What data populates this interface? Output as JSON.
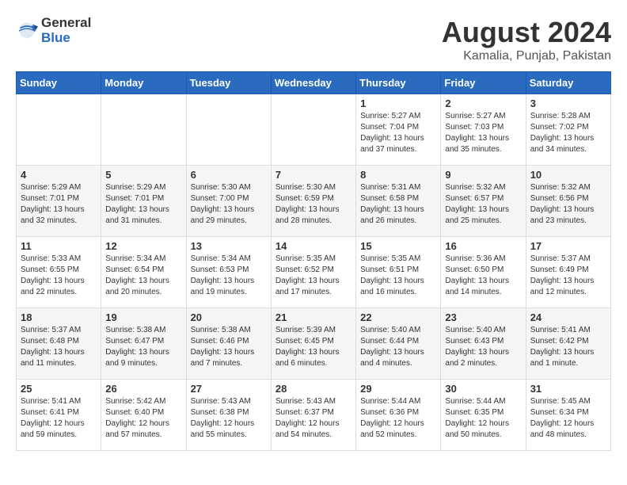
{
  "header": {
    "logo_general": "General",
    "logo_blue": "Blue",
    "month_year": "August 2024",
    "location": "Kamalia, Punjab, Pakistan"
  },
  "days_of_week": [
    "Sunday",
    "Monday",
    "Tuesday",
    "Wednesday",
    "Thursday",
    "Friday",
    "Saturday"
  ],
  "weeks": [
    [
      {
        "day": "",
        "info": ""
      },
      {
        "day": "",
        "info": ""
      },
      {
        "day": "",
        "info": ""
      },
      {
        "day": "",
        "info": ""
      },
      {
        "day": "1",
        "info": "Sunrise: 5:27 AM\nSunset: 7:04 PM\nDaylight: 13 hours and 37 minutes."
      },
      {
        "day": "2",
        "info": "Sunrise: 5:27 AM\nSunset: 7:03 PM\nDaylight: 13 hours and 35 minutes."
      },
      {
        "day": "3",
        "info": "Sunrise: 5:28 AM\nSunset: 7:02 PM\nDaylight: 13 hours and 34 minutes."
      }
    ],
    [
      {
        "day": "4",
        "info": "Sunrise: 5:29 AM\nSunset: 7:01 PM\nDaylight: 13 hours and 32 minutes."
      },
      {
        "day": "5",
        "info": "Sunrise: 5:29 AM\nSunset: 7:01 PM\nDaylight: 13 hours and 31 minutes."
      },
      {
        "day": "6",
        "info": "Sunrise: 5:30 AM\nSunset: 7:00 PM\nDaylight: 13 hours and 29 minutes."
      },
      {
        "day": "7",
        "info": "Sunrise: 5:30 AM\nSunset: 6:59 PM\nDaylight: 13 hours and 28 minutes."
      },
      {
        "day": "8",
        "info": "Sunrise: 5:31 AM\nSunset: 6:58 PM\nDaylight: 13 hours and 26 minutes."
      },
      {
        "day": "9",
        "info": "Sunrise: 5:32 AM\nSunset: 6:57 PM\nDaylight: 13 hours and 25 minutes."
      },
      {
        "day": "10",
        "info": "Sunrise: 5:32 AM\nSunset: 6:56 PM\nDaylight: 13 hours and 23 minutes."
      }
    ],
    [
      {
        "day": "11",
        "info": "Sunrise: 5:33 AM\nSunset: 6:55 PM\nDaylight: 13 hours and 22 minutes."
      },
      {
        "day": "12",
        "info": "Sunrise: 5:34 AM\nSunset: 6:54 PM\nDaylight: 13 hours and 20 minutes."
      },
      {
        "day": "13",
        "info": "Sunrise: 5:34 AM\nSunset: 6:53 PM\nDaylight: 13 hours and 19 minutes."
      },
      {
        "day": "14",
        "info": "Sunrise: 5:35 AM\nSunset: 6:52 PM\nDaylight: 13 hours and 17 minutes."
      },
      {
        "day": "15",
        "info": "Sunrise: 5:35 AM\nSunset: 6:51 PM\nDaylight: 13 hours and 16 minutes."
      },
      {
        "day": "16",
        "info": "Sunrise: 5:36 AM\nSunset: 6:50 PM\nDaylight: 13 hours and 14 minutes."
      },
      {
        "day": "17",
        "info": "Sunrise: 5:37 AM\nSunset: 6:49 PM\nDaylight: 13 hours and 12 minutes."
      }
    ],
    [
      {
        "day": "18",
        "info": "Sunrise: 5:37 AM\nSunset: 6:48 PM\nDaylight: 13 hours and 11 minutes."
      },
      {
        "day": "19",
        "info": "Sunrise: 5:38 AM\nSunset: 6:47 PM\nDaylight: 13 hours and 9 minutes."
      },
      {
        "day": "20",
        "info": "Sunrise: 5:38 AM\nSunset: 6:46 PM\nDaylight: 13 hours and 7 minutes."
      },
      {
        "day": "21",
        "info": "Sunrise: 5:39 AM\nSunset: 6:45 PM\nDaylight: 13 hours and 6 minutes."
      },
      {
        "day": "22",
        "info": "Sunrise: 5:40 AM\nSunset: 6:44 PM\nDaylight: 13 hours and 4 minutes."
      },
      {
        "day": "23",
        "info": "Sunrise: 5:40 AM\nSunset: 6:43 PM\nDaylight: 13 hours and 2 minutes."
      },
      {
        "day": "24",
        "info": "Sunrise: 5:41 AM\nSunset: 6:42 PM\nDaylight: 13 hours and 1 minute."
      }
    ],
    [
      {
        "day": "25",
        "info": "Sunrise: 5:41 AM\nSunset: 6:41 PM\nDaylight: 12 hours and 59 minutes."
      },
      {
        "day": "26",
        "info": "Sunrise: 5:42 AM\nSunset: 6:40 PM\nDaylight: 12 hours and 57 minutes."
      },
      {
        "day": "27",
        "info": "Sunrise: 5:43 AM\nSunset: 6:38 PM\nDaylight: 12 hours and 55 minutes."
      },
      {
        "day": "28",
        "info": "Sunrise: 5:43 AM\nSunset: 6:37 PM\nDaylight: 12 hours and 54 minutes."
      },
      {
        "day": "29",
        "info": "Sunrise: 5:44 AM\nSunset: 6:36 PM\nDaylight: 12 hours and 52 minutes."
      },
      {
        "day": "30",
        "info": "Sunrise: 5:44 AM\nSunset: 6:35 PM\nDaylight: 12 hours and 50 minutes."
      },
      {
        "day": "31",
        "info": "Sunrise: 5:45 AM\nSunset: 6:34 PM\nDaylight: 12 hours and 48 minutes."
      }
    ]
  ]
}
